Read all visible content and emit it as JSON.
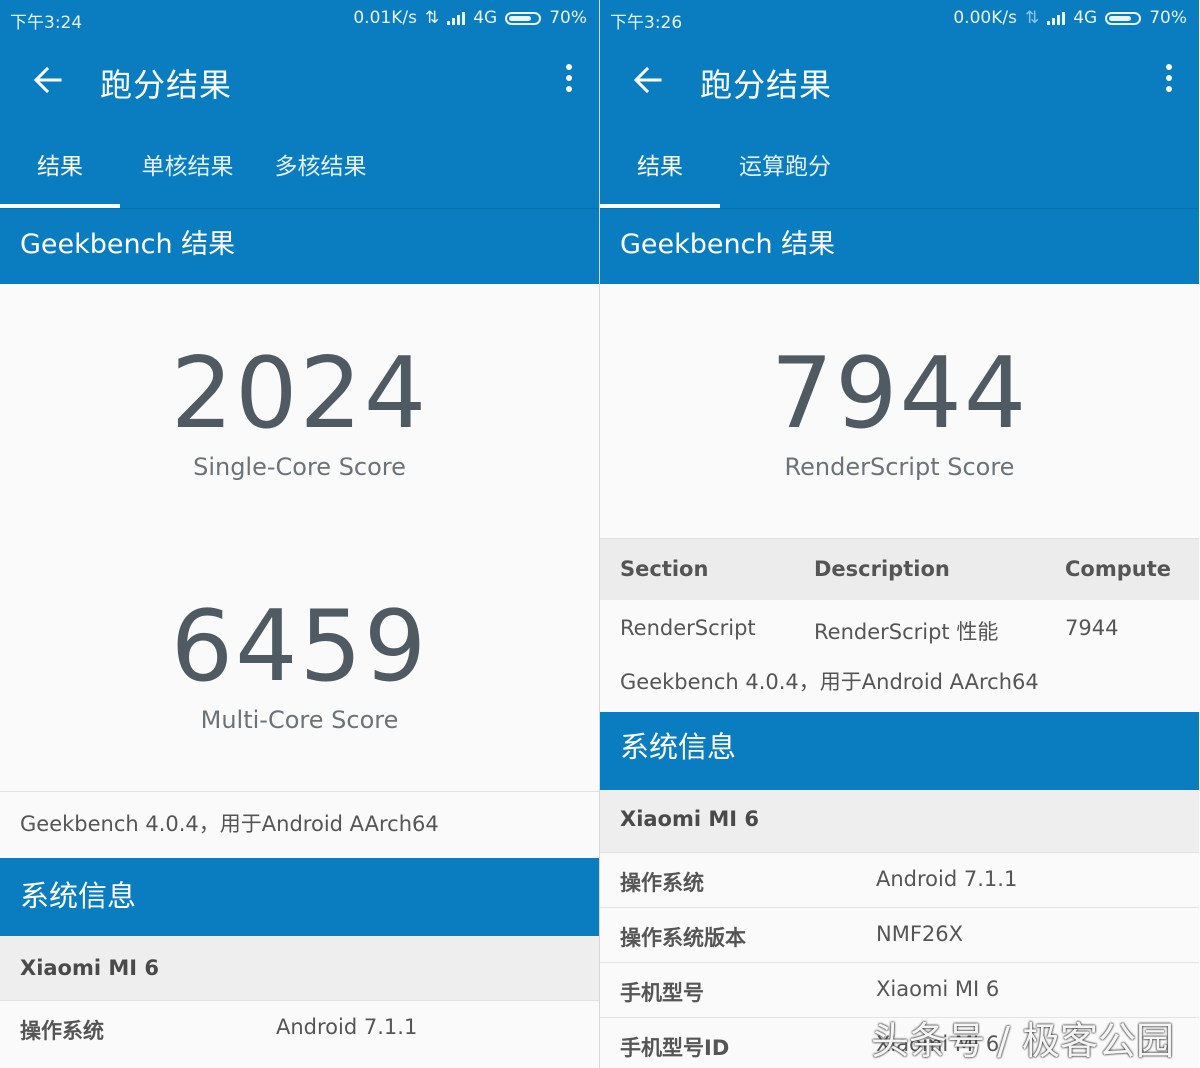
{
  "left": {
    "status": {
      "time": "下午3:24",
      "speed": "0.01K/s",
      "network": "4G",
      "battery": "70%"
    },
    "title": "跑分结果",
    "tabs": [
      "结果",
      "单核结果",
      "多核结果"
    ],
    "section_title": "Geekbench 结果",
    "single_score": "2024",
    "single_label": "Single-Core Score",
    "multi_score": "6459",
    "multi_label": "Multi-Core Score",
    "version_line": "Geekbench 4.0.4，用于Android AArch64",
    "sysinfo_title": "系统信息",
    "device": "Xiaomi MI 6",
    "rows": [
      {
        "k": "操作系统",
        "v": "Android 7.1.1"
      }
    ]
  },
  "right": {
    "status": {
      "time": "下午3:26",
      "speed": "0.00K/s",
      "network": "4G",
      "battery": "70%"
    },
    "title": "跑分结果",
    "tabs": [
      "结果",
      "运算跑分"
    ],
    "section_title": "Geekbench 结果",
    "score": "7944",
    "score_label": "RenderScript Score",
    "table": {
      "headers": [
        "Section",
        "Description",
        "Compute"
      ],
      "row": [
        "RenderScript",
        "RenderScript 性能",
        "7944"
      ]
    },
    "version_line": "Geekbench 4.0.4，用于Android AArch64",
    "sysinfo_title": "系统信息",
    "device": "Xiaomi MI 6",
    "rows": [
      {
        "k": "操作系统",
        "v": "Android 7.1.1"
      },
      {
        "k": "操作系统版本",
        "v": "NMF26X"
      },
      {
        "k": "手机型号",
        "v": "Xiaomi MI 6"
      },
      {
        "k": "手机型号ID",
        "v": "Xiaomi MI 6"
      }
    ]
  },
  "watermark": "头条号 / 极客公园",
  "colors": {
    "primary": "#0a7cc0",
    "score_text": "#505a63",
    "background": "#fafafa",
    "row_gray": "#eeeeee"
  }
}
